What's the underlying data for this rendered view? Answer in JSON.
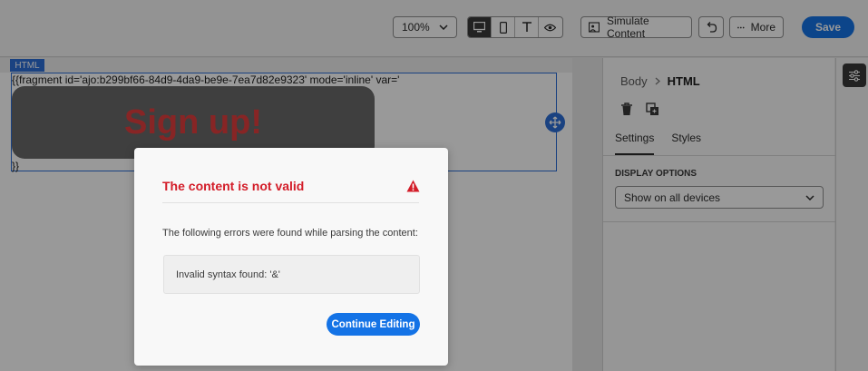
{
  "toolbar": {
    "zoom_value": "100%",
    "view_modes": [
      "desktop-icon",
      "mobile-icon",
      "text-icon",
      "eye-icon"
    ],
    "simulate_label": "Simulate Content",
    "more_label": "More",
    "save_label": "Save"
  },
  "canvas": {
    "component_tag": "HTML",
    "fragment_text": "{{fragment id='ajo:b299bf66-84d9-4da9-be9e-7ea7d82e9323' mode='inline' var='",
    "fragment_end": "}}",
    "signup_text": "Sign up!"
  },
  "panel": {
    "breadcrumb": [
      "Body",
      "HTML"
    ],
    "tabs": [
      "Settings",
      "Styles"
    ],
    "display_options_label": "DISPLAY OPTIONS",
    "display_options_value": "Show on all devices"
  },
  "dialog": {
    "title": "The content is not valid",
    "message": "The following errors were found while parsing the content:",
    "error": "Invalid syntax found: '&'",
    "continue_label": "Continue Editing"
  },
  "colors": {
    "accent": "#1473e6",
    "error": "#d31c28",
    "selection": "#2c6ed8"
  }
}
